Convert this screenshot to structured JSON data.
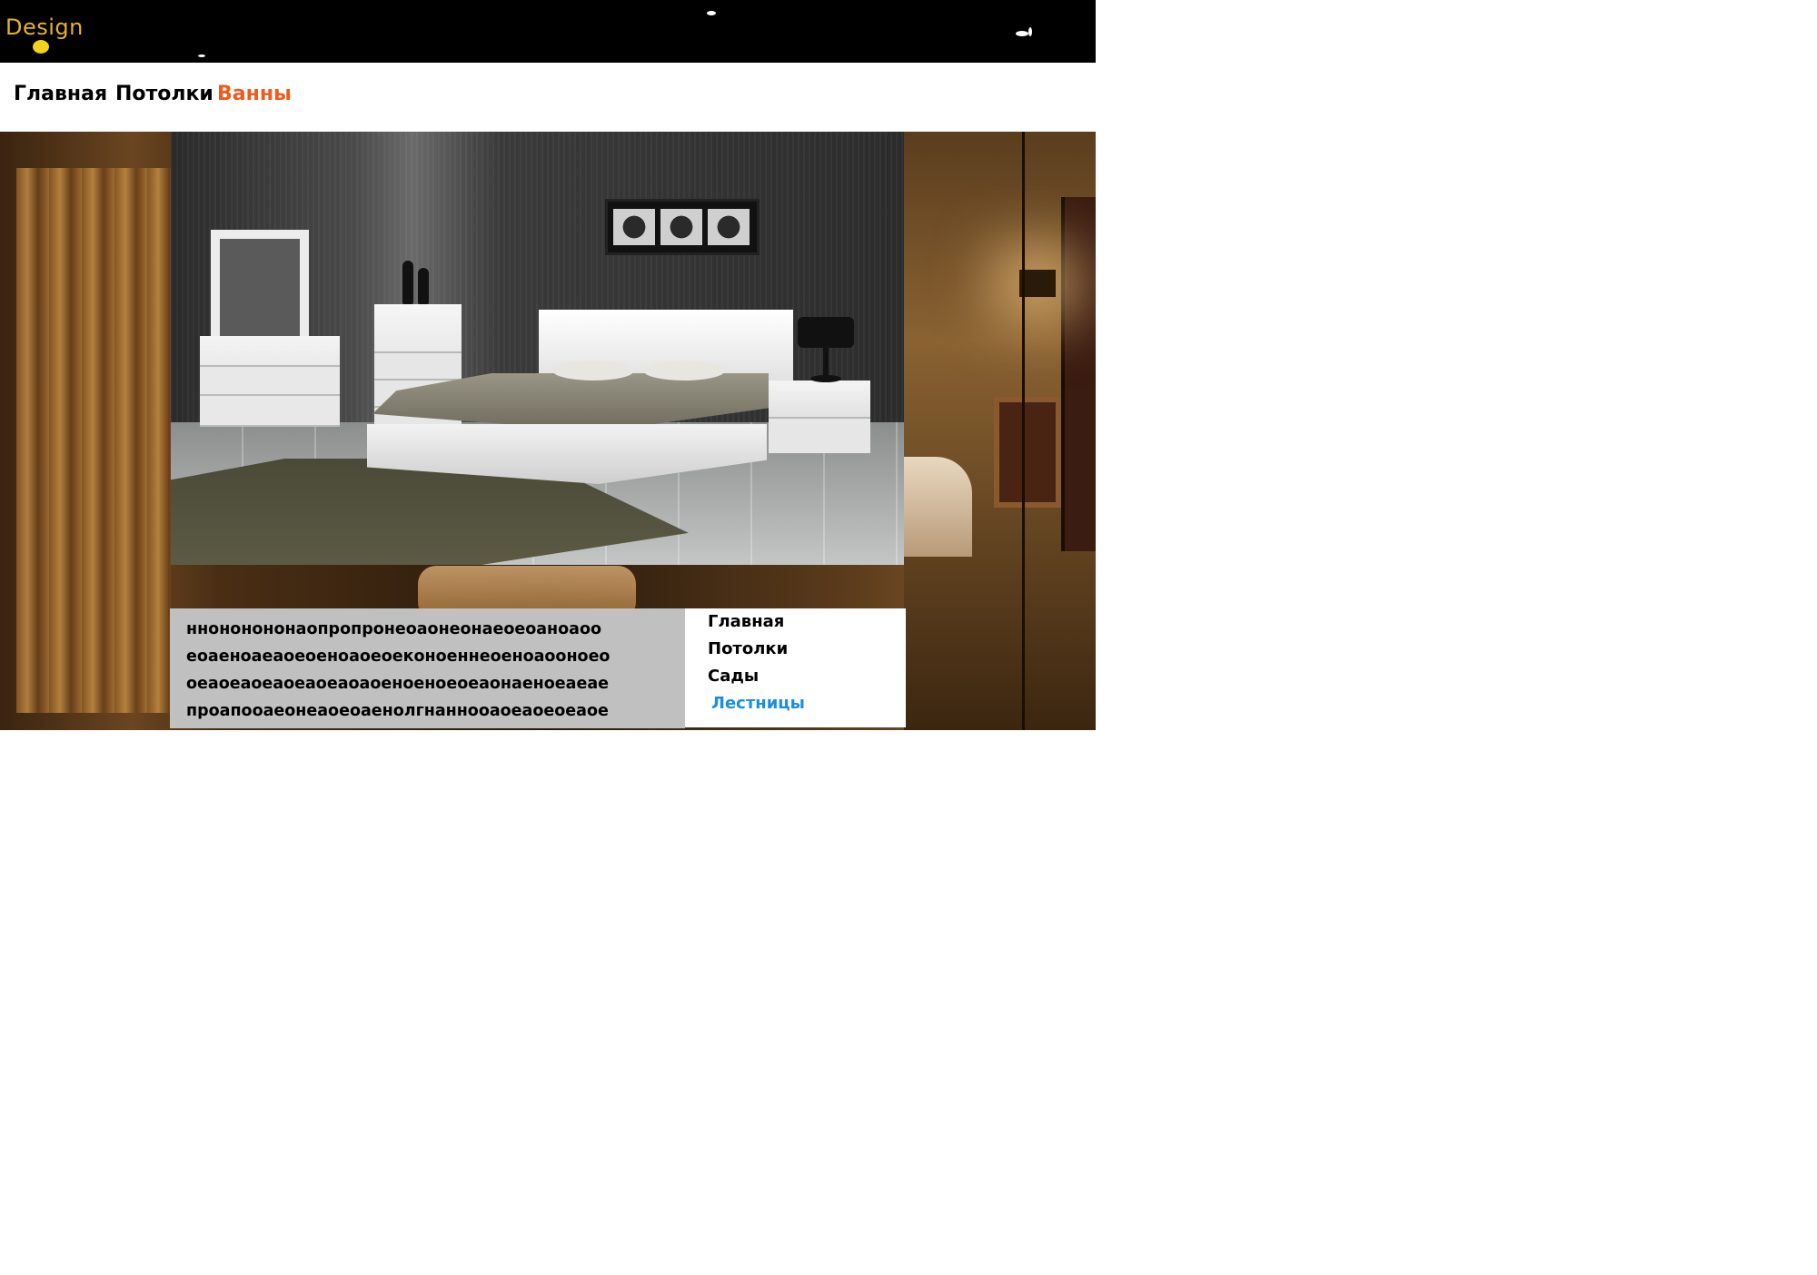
{
  "header": {
    "logo_text": "Design",
    "colors": {
      "background": "#000000",
      "logo_text": "#e8b41a",
      "logo_dot": "#f2d21c"
    }
  },
  "topnav": {
    "items": [
      {
        "label": "Главная",
        "active": false
      },
      {
        "label": "Потолки",
        "active": false
      },
      {
        "label": "Ванны",
        "active": true
      }
    ],
    "colors": {
      "default": "#000000",
      "active": "#f05a1a"
    }
  },
  "hero": {
    "icon": "bedroom-photo"
  },
  "background": {
    "icon": "interior-photo"
  },
  "content": {
    "lines": [
      "ннононононаопропронеоаонеонаеоеоаноаоо",
      "еоаеноаеаоеоеноаоеоеконоеннеоеноаооноео",
      "оеаоеаоеаоеаоеаоаоеноеноеоеаонаеноеаеае",
      "проапооаеонеаоеоаенолгнанноoaоеаоеоеаое"
    ],
    "colors": {
      "background": "#c0c0c0"
    }
  },
  "sidebar": {
    "items": [
      {
        "label": "Главная",
        "active": false
      },
      {
        "label": "Потолки",
        "active": false
      },
      {
        "label": "Сады",
        "active": false
      },
      {
        "label": "Лестницы",
        "active": true
      }
    ],
    "colors": {
      "default": "#000000",
      "active": "#1a8ee6"
    }
  }
}
